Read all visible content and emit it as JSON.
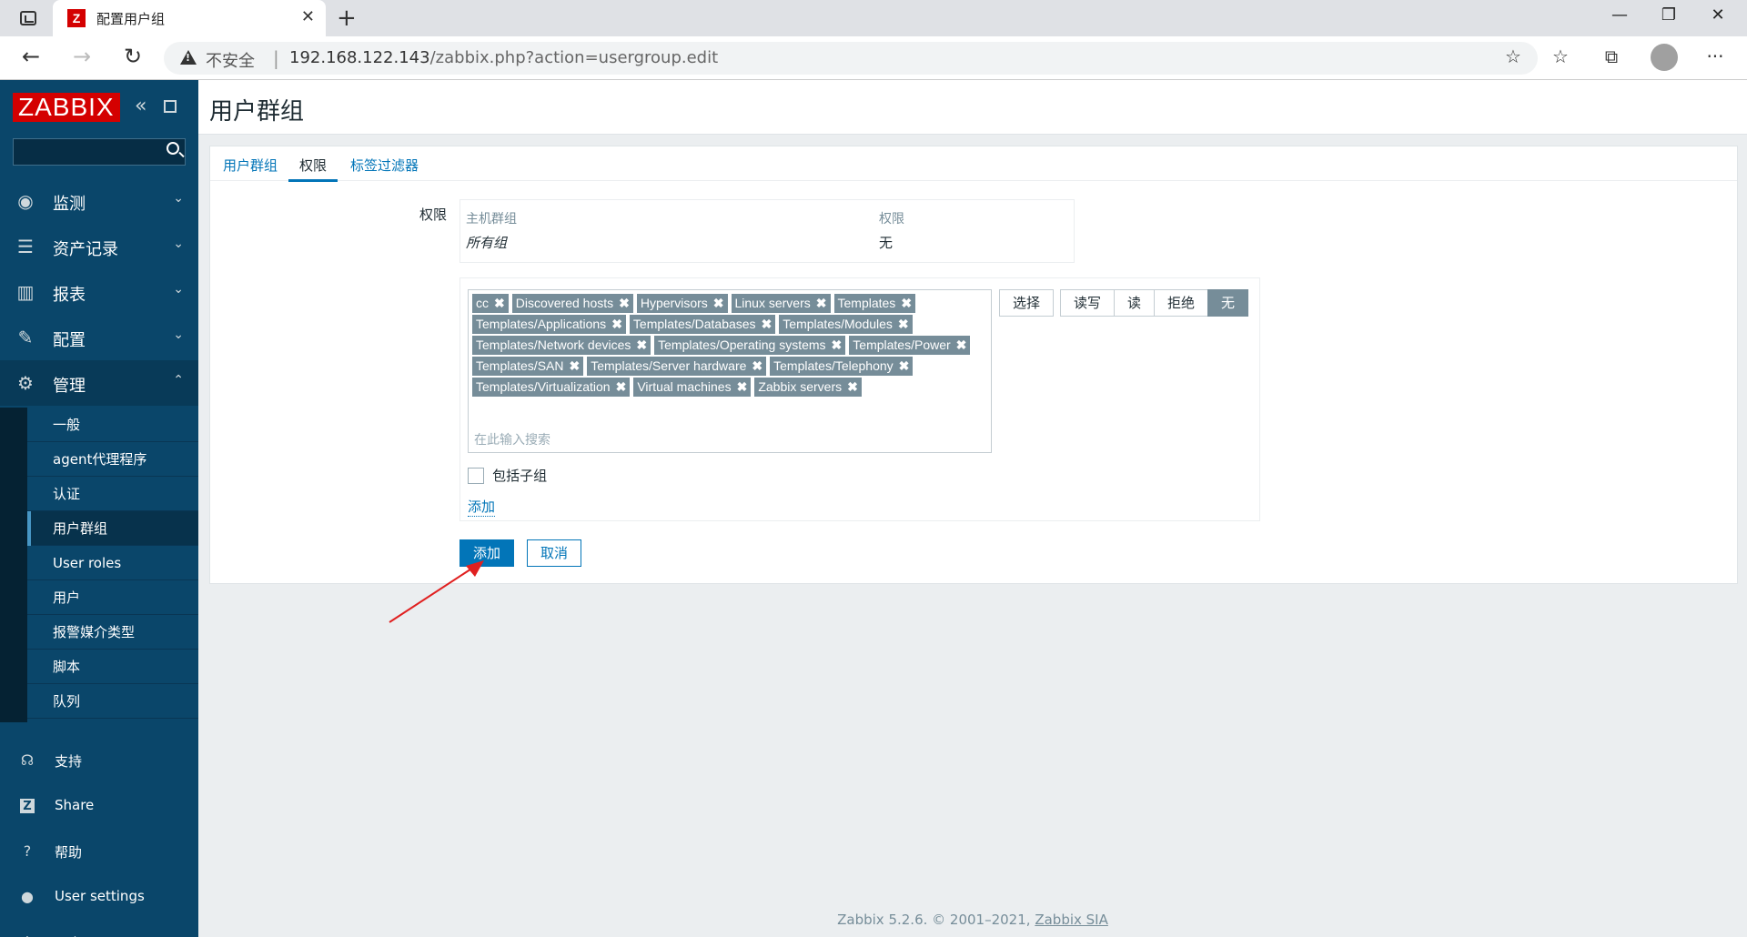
{
  "browser": {
    "tab_title": "配置用户组",
    "favicon": "Z",
    "security_label": "不安全",
    "url_host": "192.168.122.143",
    "url_path": "/zabbix.php?action=usergroup.edit"
  },
  "sidebar": {
    "logo": "ZABBIX",
    "menu": [
      {
        "label": "监测",
        "icon": "eye-icon"
      },
      {
        "label": "资产记录",
        "icon": "list-icon"
      },
      {
        "label": "报表",
        "icon": "chart-icon"
      },
      {
        "label": "配置",
        "icon": "wrench-icon"
      },
      {
        "label": "管理",
        "icon": "gear-icon"
      }
    ],
    "submenu": [
      "一般",
      "agent代理程序",
      "认证",
      "用户群组",
      "User roles",
      "用户",
      "报警媒介类型",
      "脚本",
      "队列"
    ],
    "active_submenu": "用户群组",
    "bottom": [
      {
        "label": "支持",
        "icon": "headset-icon"
      },
      {
        "label": "Share",
        "icon": "share-icon"
      },
      {
        "label": "帮助",
        "icon": "help-icon"
      },
      {
        "label": "User settings",
        "icon": "user-icon"
      },
      {
        "label": "退出",
        "icon": "power-icon"
      }
    ]
  },
  "page": {
    "title": "用户群组",
    "tabs": [
      "用户群组",
      "权限",
      "标签过滤器"
    ],
    "active_tab": "权限",
    "permissions_label": "权限",
    "table": {
      "col_group": "主机群组",
      "col_perm": "权限",
      "row_group": "所有组",
      "row_perm": "无"
    },
    "chips": [
      "cc",
      "Discovered hosts",
      "Hypervisors",
      "Linux servers",
      "Templates",
      "Templates/Applications",
      "Templates/Databases",
      "Templates/Modules",
      "Templates/Network devices",
      "Templates/Operating systems",
      "Templates/Power",
      "Templates/SAN",
      "Templates/Server hardware",
      "Templates/Telephony",
      "Templates/Virtualization",
      "Virtual machines",
      "Zabbix servers"
    ],
    "search_placeholder": "在此输入搜索",
    "select_button": "选择",
    "perm_options": [
      "读写",
      "读",
      "拒绝",
      "无"
    ],
    "perm_selected": "无",
    "include_subgroups": "包括子组",
    "add_link": "添加",
    "add_button": "添加",
    "cancel_button": "取消"
  },
  "footer": {
    "text": "Zabbix 5.2.6. © 2001–2021,",
    "link": "Zabbix SIA"
  }
}
